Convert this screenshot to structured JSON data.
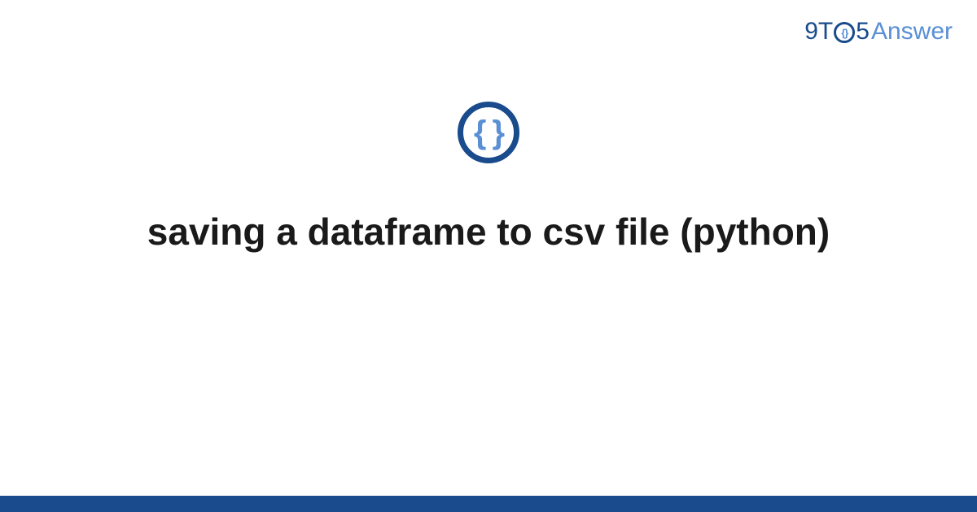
{
  "brand": {
    "part1": "9T",
    "circle_inner": "{}",
    "part2": "5",
    "part3": "Answer"
  },
  "icon": {
    "braces": "{ }"
  },
  "title": "saving a dataframe to csv file (python)",
  "colors": {
    "primary": "#1a4b8c",
    "accent": "#5a8fd4"
  }
}
